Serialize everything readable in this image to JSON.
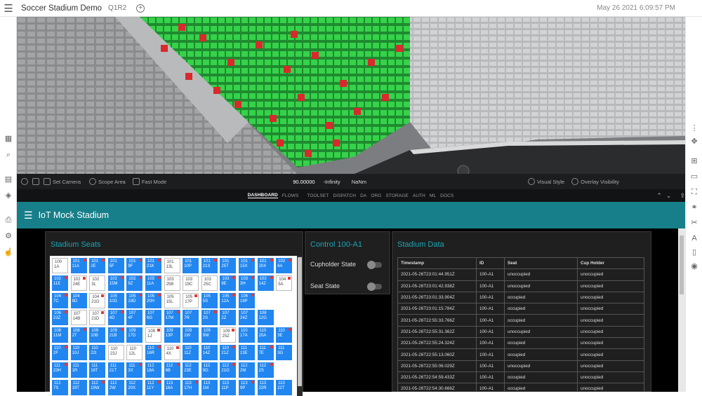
{
  "header": {
    "title": "Soccer Stadium Demo",
    "tag": "Q1R2",
    "add": "⊕",
    "datetime": "May 26 2021   6:09:57 PM"
  },
  "viewport_toolbar": {
    "set_camera": "Set Camera",
    "scope_area": "Scope Area",
    "fast_mode": "Fast Mode",
    "value": "90.00000",
    "neg_inf": "-Infinity",
    "nan": "NaNm",
    "visual_style": "Visual Style",
    "overlay_visibility": "Overlay Visibility"
  },
  "nav_tabs": [
    "DASHBOARD",
    "FLOWS",
    "TOOLSET",
    "DISPATCH",
    "DA",
    "ORG",
    "STORAGE",
    "AUTH",
    "ML",
    "DOCS"
  ],
  "app": {
    "title": "IoT Mock Stadium"
  },
  "seats_panel": {
    "title": "Stadium Seats",
    "seats": [
      [
        "100\n1A",
        "101\n11A",
        "101\n2E",
        "101\n5F",
        "101\n9F",
        "101\n21K",
        "101\n13L",
        "101\n10P",
        "101\n21S",
        "101\n25T",
        "101\n15X",
        "101\n20X",
        "102\n6A"
      ],
      [
        "102\n11E",
        "102\n24E",
        "102\n3L",
        "102\n15M",
        "102\n9Z",
        "103\n11A",
        "103\n25B",
        "103\n19C",
        "103\n25C",
        "103\n9E",
        "103\n3H",
        "103\n14Z",
        "104\n5A"
      ],
      [
        "104\n7C",
        "104\n8D",
        "104\n21G",
        "105\n10D",
        "105\n19D",
        "105\n20H",
        "105\n15L",
        "105\n17P",
        "105\n5S",
        "105\n12A",
        "106\n19P",
        "",
        ""
      ],
      [
        "106\n23Z",
        "107\n14B",
        "107\n21D",
        "107\n4D",
        "107\n4F",
        "107\n6G",
        "107\n17M",
        "107\n7R",
        "107\n2S",
        "107\n2Z",
        "107\n24Z",
        "108\n12G",
        ""
      ],
      [
        "108\n11M",
        "108\n2T",
        "109\n10B",
        "109\n21B",
        "109\n17D",
        "109\n1J",
        "109\n13P",
        "109\n1W",
        "109\n9W",
        "109\n25Z",
        "110\n17A",
        "110\n20A",
        "110\n3E"
      ],
      [
        "110\n2F",
        "110\n10J",
        "110\n22I",
        "110\n23J",
        "110\n12L",
        "110\n16R",
        "110\n4X",
        "110\n11Z",
        "110\n14Z",
        "110\n21Z",
        "111\n13E",
        "111\n7E",
        "111\n3G"
      ],
      [
        "111\n23H",
        "111\n1R",
        "111\n18T",
        "111\n21T",
        "111\n3X",
        "112\n18A",
        "112\n6B",
        "112\n23E",
        "112\n9G",
        "112\n21G",
        "112\n2M",
        "112\n2S",
        ""
      ],
      [
        "112\n7S",
        "112\n19T",
        "112\n19W",
        "112\n2W",
        "112\n20X",
        "112\n11Y",
        "113\n16A",
        "113\n17H",
        "113\n1M",
        "113\n11P",
        "113\n9P",
        "113\n22R",
        "113\n22T"
      ]
    ]
  },
  "control_panel": {
    "title": "Control 100-A1",
    "cupholder_label": "Cupholder State",
    "seat_label": "Seat State"
  },
  "data_panel": {
    "title": "Stadium Data",
    "columns": [
      "Timestamp",
      "ID",
      "Seat",
      "Cup Holder"
    ],
    "rows": [
      [
        "2021-05-26T23:01:44.951Z",
        "100-A1",
        "unoccupied",
        "unoccupied"
      ],
      [
        "2021-05-26T23:01:42.938Z",
        "100-A1",
        "unoccupied",
        "unoccupied"
      ],
      [
        "2021-05-26T23:01:33.904Z",
        "100-A1",
        "occupied",
        "unoccupied"
      ],
      [
        "2021-05-26T23:01:15.784Z",
        "100-A1",
        "occupied",
        "unoccupied"
      ],
      [
        "2021-05-26T22:55:33.766Z",
        "100-A1",
        "occupied",
        "unoccupied"
      ],
      [
        "2021-05-26T22:55:31.362Z",
        "100-A1",
        "unoccupied",
        "unoccupied"
      ],
      [
        "2021-05-26T22:55:24.324Z",
        "100-A1",
        "occupied",
        "unoccupied"
      ],
      [
        "2021-05-26T22:55:13.060Z",
        "100-A1",
        "occupied",
        "unoccupied"
      ],
      [
        "2021-05-26T22:55:06.029Z",
        "100-A1",
        "unoccupied",
        "unoccupied"
      ],
      [
        "2021-05-26T22:54:59.433Z",
        "100-A1",
        "occupied",
        "unoccupied"
      ],
      [
        "2021-05-26T22:54:30.666Z",
        "100-A1",
        "occupied",
        "unoccupied"
      ]
    ]
  },
  "colors": {
    "accent": "#167f89",
    "seat_blue": "#2186f0",
    "title_teal": "#1aa6b3"
  }
}
